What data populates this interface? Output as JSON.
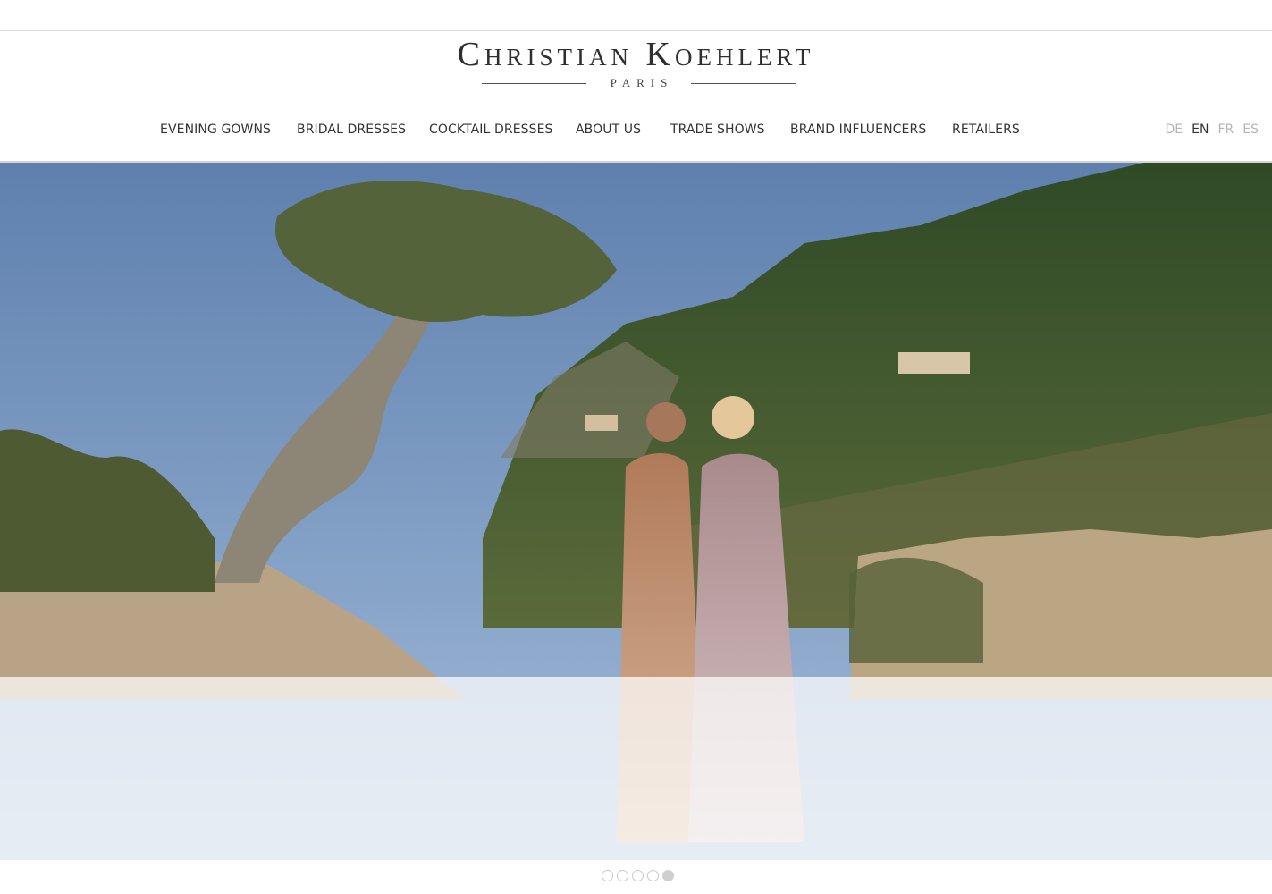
{
  "brand": {
    "name": "Christian Koehlert",
    "city": "PARIS"
  },
  "nav": {
    "items": [
      {
        "label": "EVENING GOWNS"
      },
      {
        "label": "BRIDAL DRESSES"
      },
      {
        "label": "COCKTAIL DRESSES"
      },
      {
        "label": "ABOUT US"
      },
      {
        "label": "TRADE SHOWS"
      },
      {
        "label": "BRAND INFLUENCERS"
      },
      {
        "label": "RETAILERS"
      }
    ]
  },
  "languages": {
    "items": [
      {
        "code": "DE",
        "active": false
      },
      {
        "code": "EN",
        "active": true
      },
      {
        "code": "FR",
        "active": false
      },
      {
        "code": "ES",
        "active": false
      }
    ]
  },
  "slider": {
    "slide_count": 5,
    "active_slide": 5
  },
  "colors": {
    "text": "#333333",
    "inactive_lang": "#b5b5b5",
    "dot_active": "#cfcfcf",
    "dot_border": "#c9c9c9"
  }
}
